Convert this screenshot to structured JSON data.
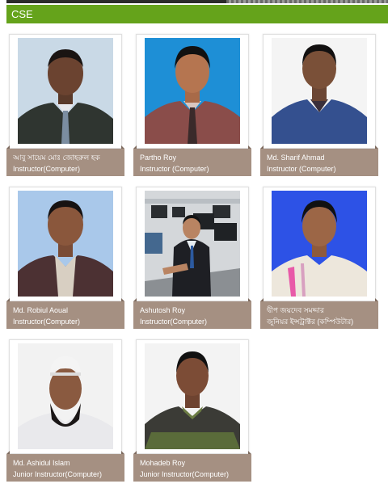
{
  "section": {
    "title": "CSE"
  },
  "staff": [
    {
      "name": "আবু সায়েম মোঃ জোহরুল হক",
      "designation": "Instructor(Computer)"
    },
    {
      "name": "Partho Roy",
      "designation": "Instructor (Computer)"
    },
    {
      "name": "Md. Sharif Ahmad",
      "designation": "Instructor (Computer)"
    },
    {
      "name": "Md. Robiul Aoual",
      "designation": "Instructor(Computer)"
    },
    {
      "name": "Ashutosh Roy",
      "designation": "Instructor(Computer)"
    },
    {
      "name": "দ্বীপ জয়দেব সমদ্দার",
      "designation": "জুনিয়র ইন্সট্রাক্টর (কম্পিউটার)"
    },
    {
      "name": "Md. Ashidul Islam",
      "designation": "Junior Instructor(Computer)"
    },
    {
      "name": "Mohadeb Roy",
      "designation": "Junior Instructor(Computer)"
    }
  ]
}
